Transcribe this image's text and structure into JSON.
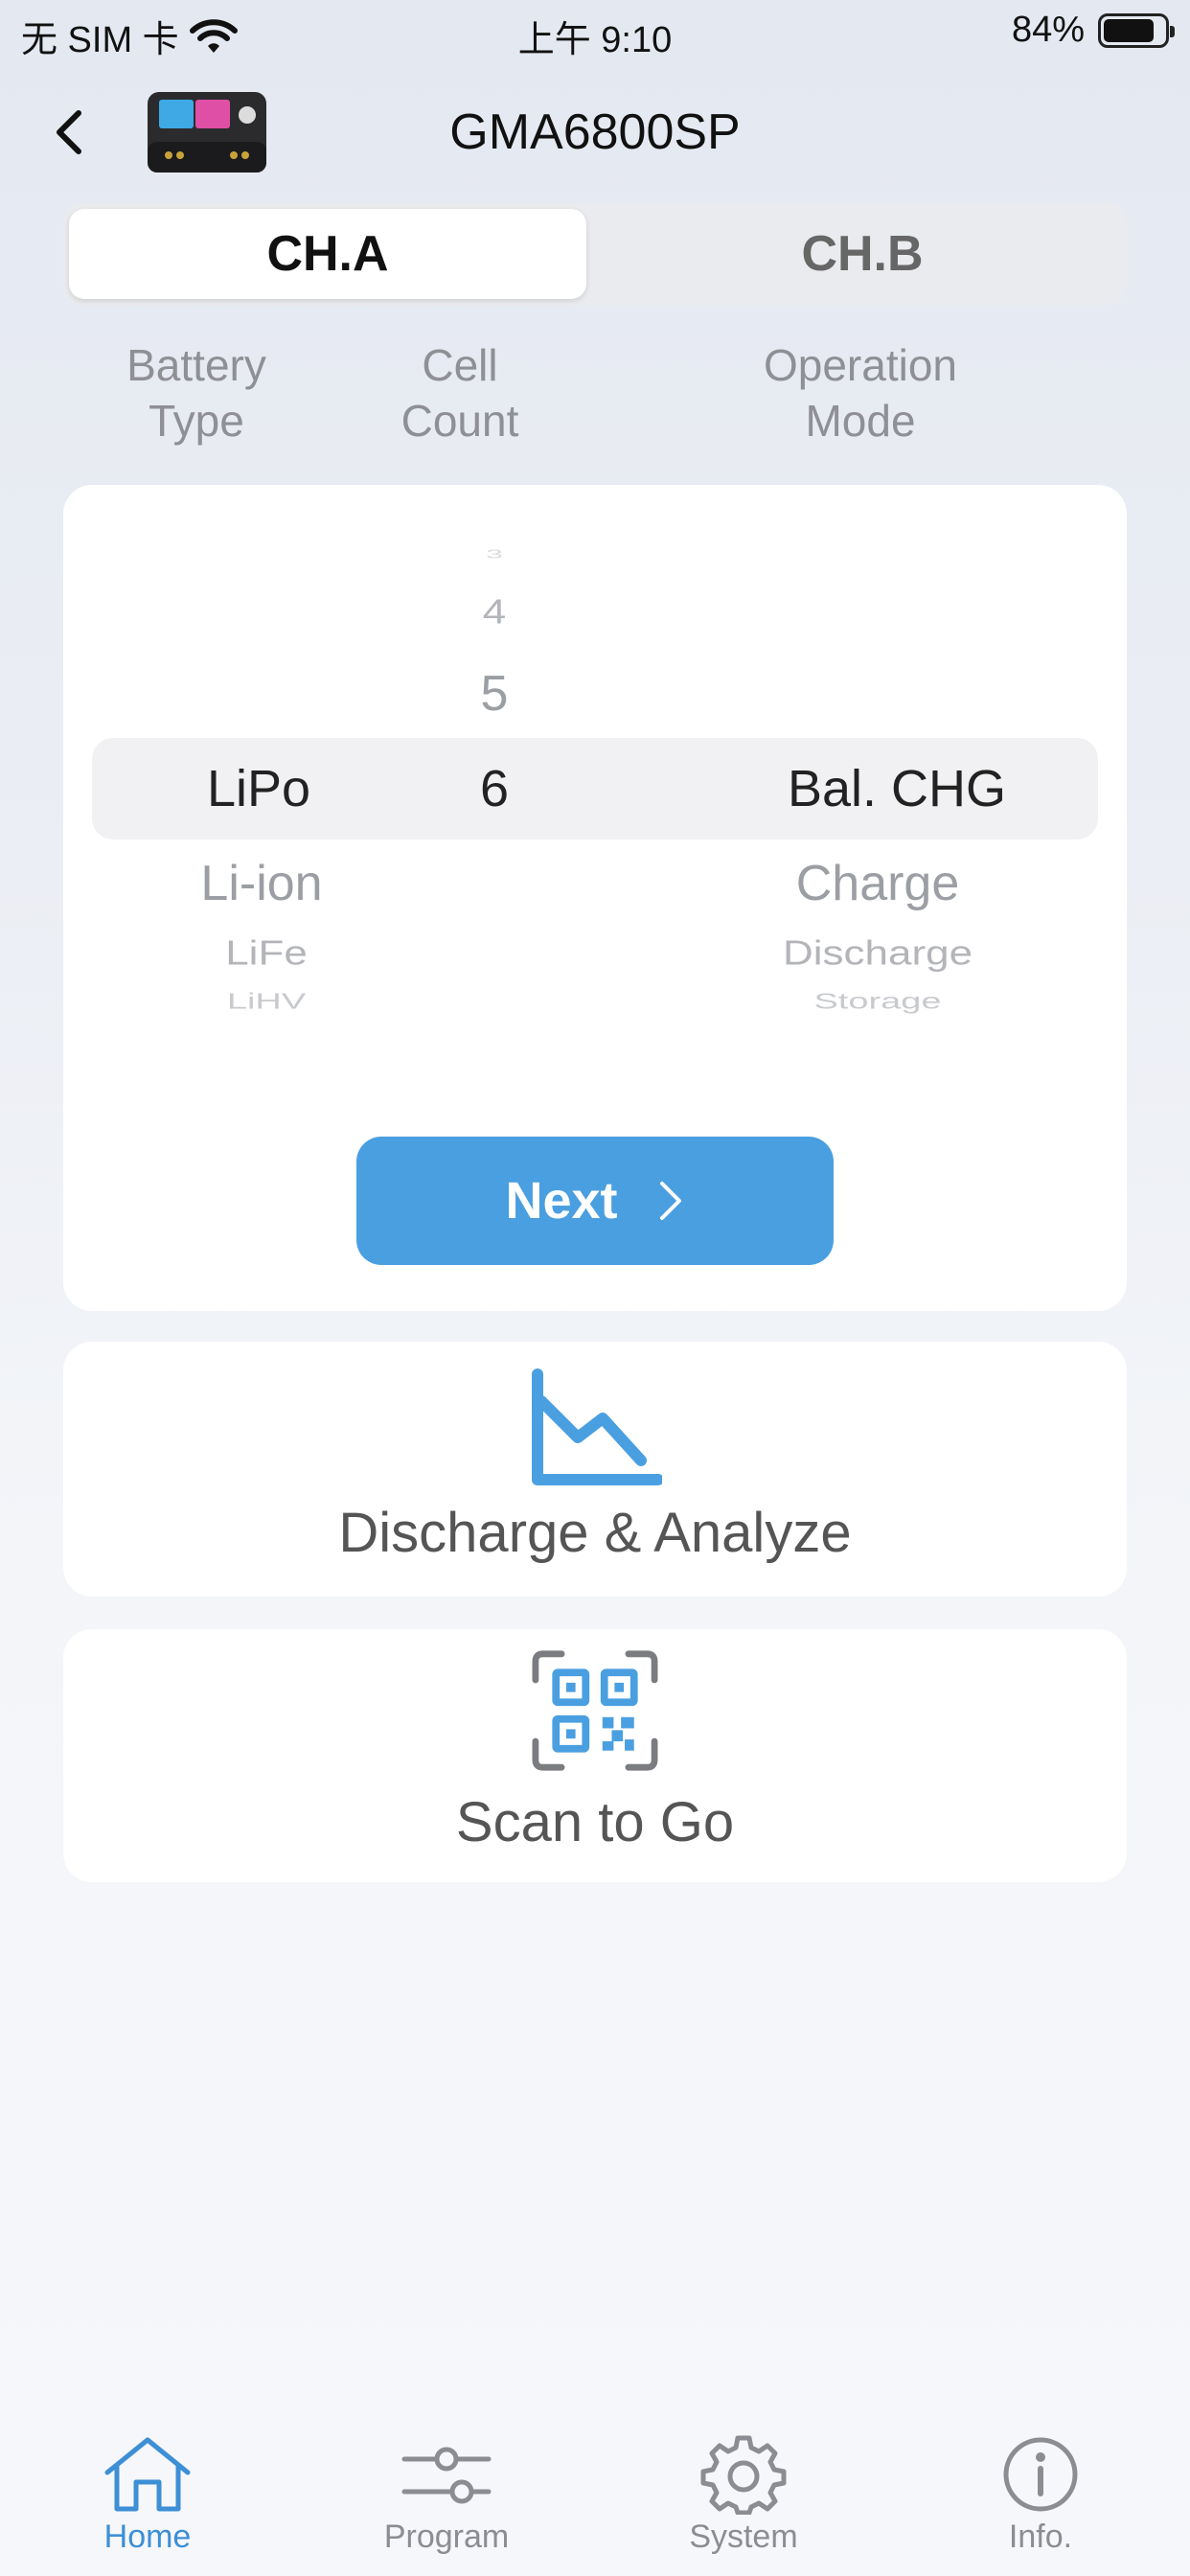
{
  "status_bar": {
    "carrier": "无 SIM 卡",
    "time": "上午 9:10",
    "battery": "84%",
    "battery_level": 0.84
  },
  "nav": {
    "title": "GMA6800SP"
  },
  "channels": {
    "a": "CH.A",
    "b": "CH.B",
    "selected": "CH.A"
  },
  "columns": {
    "battery_type": [
      "Battery",
      "Type"
    ],
    "cell_count": [
      "Cell",
      "Count"
    ],
    "operation_mode": [
      "Operation",
      "Mode"
    ]
  },
  "picker": {
    "battery_type": {
      "selected": "LiPo",
      "below": [
        "Li-ion",
        "LiFe",
        "LiHV"
      ]
    },
    "cell_count": {
      "above": [
        "3",
        "4",
        "5"
      ],
      "selected": "6"
    },
    "operation_mode": {
      "selected": "Bal. CHG",
      "below": [
        "Charge",
        "Discharge",
        "Storage"
      ]
    }
  },
  "next_button": {
    "label": "Next"
  },
  "discharge_card": {
    "label": "Discharge & Analyze",
    "icon": "chart-icon"
  },
  "scan_card": {
    "label": "Scan to Go",
    "icon": "qr-scan-icon"
  },
  "tabbar": {
    "items": [
      {
        "label": "Home",
        "icon": "home-icon",
        "active": true
      },
      {
        "label": "Program",
        "icon": "sliders-icon",
        "active": false
      },
      {
        "label": "System",
        "icon": "gear-icon",
        "active": false
      },
      {
        "label": "Info.",
        "icon": "info-icon",
        "active": false
      }
    ]
  },
  "colors": {
    "accent": "#4a9fe0",
    "active_tab": "#3d8fd6",
    "inactive_tab": "#8b8d92"
  }
}
